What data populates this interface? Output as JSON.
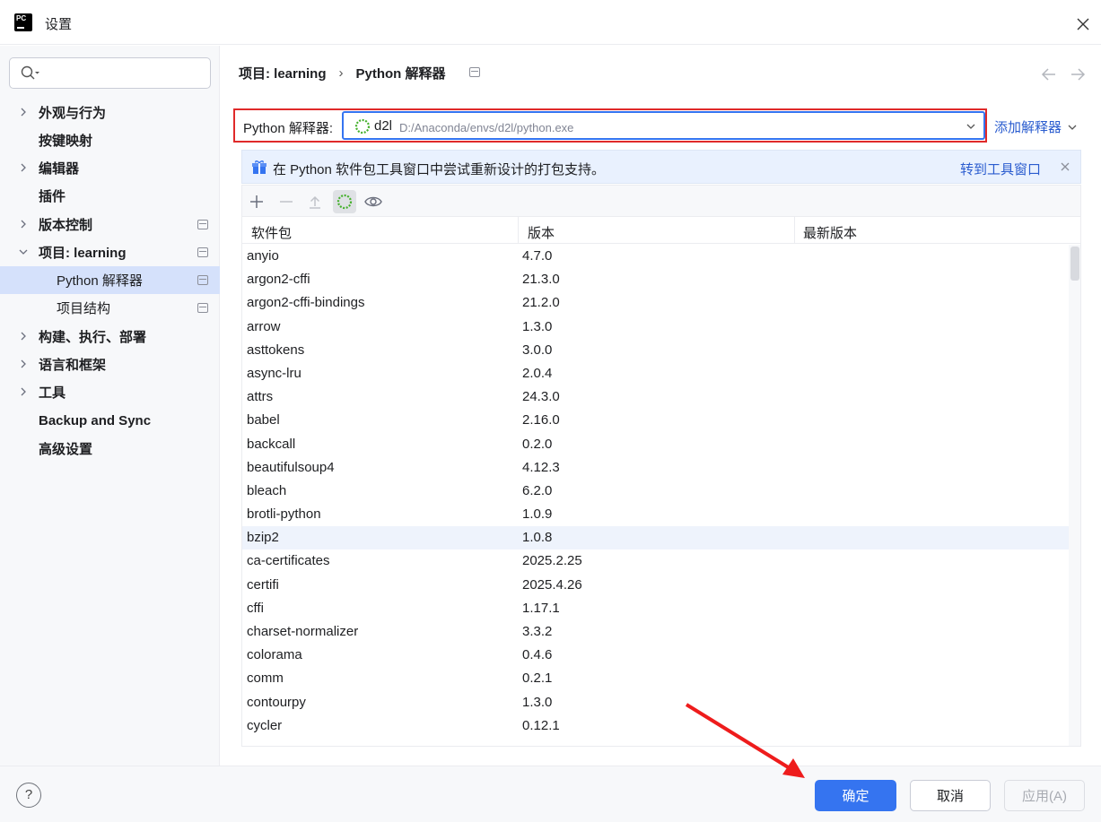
{
  "window": {
    "title": "设置"
  },
  "sidebar": {
    "search_placeholder": "",
    "items": [
      {
        "label": "外观与行为",
        "expandable": true,
        "page": false
      },
      {
        "label": "按键映射",
        "expandable": false,
        "page": false
      },
      {
        "label": "编辑器",
        "expandable": true,
        "page": false
      },
      {
        "label": "插件",
        "expandable": false,
        "page": false
      },
      {
        "label": "版本控制",
        "expandable": true,
        "page": true
      },
      {
        "label": "项目: learning",
        "expandable": true,
        "expanded": true,
        "page": true
      },
      {
        "label": "Python 解释器",
        "sub": true,
        "selected": true,
        "page": true
      },
      {
        "label": "项目结构",
        "sub": true,
        "page": true
      },
      {
        "label": "构建、执行、部署",
        "expandable": true,
        "page": false
      },
      {
        "label": "语言和框架",
        "expandable": true,
        "page": false
      },
      {
        "label": "工具",
        "expandable": true,
        "page": false
      },
      {
        "label": "Backup and Sync",
        "expandable": false,
        "page": false
      },
      {
        "label": "高级设置",
        "expandable": false,
        "page": false
      }
    ]
  },
  "breadcrumb": {
    "project": "项目: learning",
    "sep": "›",
    "page": "Python 解释器"
  },
  "interpreter": {
    "label": "Python 解释器:",
    "name": "d2l",
    "path": "D:/Anaconda/envs/d2l/python.exe",
    "add_label": "添加解释器"
  },
  "banner": {
    "text": "在 Python 软件包工具窗口中尝试重新设计的打包支持。",
    "link": "转到工具窗口"
  },
  "table": {
    "headers": [
      "软件包",
      "版本",
      "最新版本"
    ],
    "rows": [
      {
        "name": "anyio",
        "version": "4.7.0"
      },
      {
        "name": "argon2-cffi",
        "version": "21.3.0"
      },
      {
        "name": "argon2-cffi-bindings",
        "version": "21.2.0"
      },
      {
        "name": "arrow",
        "version": "1.3.0"
      },
      {
        "name": "asttokens",
        "version": "3.0.0"
      },
      {
        "name": "async-lru",
        "version": "2.0.4"
      },
      {
        "name": "attrs",
        "version": "24.3.0"
      },
      {
        "name": "babel",
        "version": "2.16.0"
      },
      {
        "name": "backcall",
        "version": "0.2.0"
      },
      {
        "name": "beautifulsoup4",
        "version": "4.12.3"
      },
      {
        "name": "bleach",
        "version": "6.2.0"
      },
      {
        "name": "brotli-python",
        "version": "1.0.9"
      },
      {
        "name": "bzip2",
        "version": "1.0.8",
        "highlight": true
      },
      {
        "name": "ca-certificates",
        "version": "2025.2.25"
      },
      {
        "name": "certifi",
        "version": "2025.4.26"
      },
      {
        "name": "cffi",
        "version": "1.17.1"
      },
      {
        "name": "charset-normalizer",
        "version": "3.3.2"
      },
      {
        "name": "colorama",
        "version": "0.4.6"
      },
      {
        "name": "comm",
        "version": "0.2.1"
      },
      {
        "name": "contourpy",
        "version": "1.3.0"
      },
      {
        "name": "cycler",
        "version": "0.12.1"
      }
    ]
  },
  "footer": {
    "help": "?",
    "ok": "确定",
    "cancel": "取消",
    "apply": "应用(A)"
  },
  "colors": {
    "accent": "#3574f0",
    "highlight_box": "#e02a2a",
    "link": "#2a5ccf",
    "selection": "#d5e1fb"
  }
}
